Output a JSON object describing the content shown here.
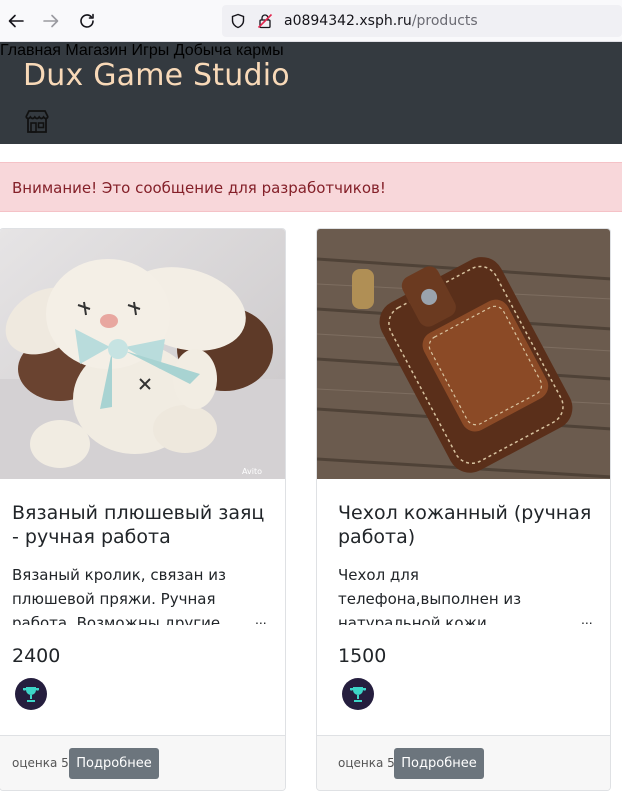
{
  "browser": {
    "url_host": "a0894342.xsph.ru",
    "url_path": "/products"
  },
  "header": {
    "brand": "Dux Game Studio",
    "brand_icon": "store-icon",
    "nav": [
      "Главная",
      "Магазин",
      "Игры",
      "Добыча кармы"
    ]
  },
  "alert": {
    "text": "Внимание! Это сообщение для разработчиков!"
  },
  "products": [
    {
      "title": "Вязаный плюшевый заяц - ручная работа",
      "description": "Вязаный кролик, связан из плюшевой пряжи. Ручная работа. Возможны другие",
      "price": "2400",
      "rating": "оценка 5",
      "button": "Подробнее",
      "image": "crochet-bunny-photo",
      "watermark": "Avito"
    },
    {
      "title": "Чехол кожанный (ручная работа)",
      "description": "Чехол для телефона,выполнен из натуральной кожи растительного дубления.",
      "price": "1500",
      "rating": "оценка 5",
      "button": "Подробнее",
      "image": "leather-phone-case-photo"
    }
  ],
  "ellipsis": "...",
  "colors": {
    "header_bg": "#343a40",
    "brand": "#f8d9b8",
    "alert_bg": "#f8d7da",
    "alert_text": "#842029",
    "button_bg": "#6c757d",
    "badge_bg": "#251e3e",
    "badge_icon": "#3dd6c8"
  }
}
